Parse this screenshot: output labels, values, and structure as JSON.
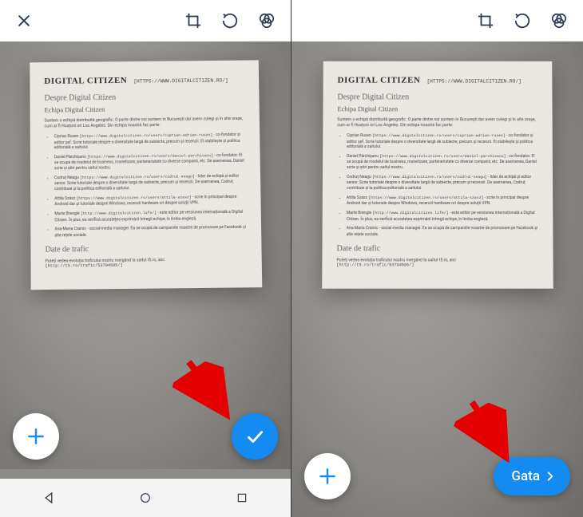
{
  "colors": {
    "accent": "#148bf0"
  },
  "topbar": {
    "close_icon": "close",
    "crop_icon": "crop",
    "rotate_icon": "rotate",
    "filters_icon": "color-filters"
  },
  "document": {
    "logo": "DIGITAL CITIZEN",
    "url": "[HTTPS://WWW.DIGITALCITIZEN.RO/]",
    "h2": "Despre Digital Citizen",
    "h3": "Echipa Digital Citizen",
    "intro": "Suntem o echipă distribuită geografic. O parte dintre noi suntem în București dar avem colegi și în alte orașe, cum ar fi Huațoni ori Los Angeles. Din echipa noastră fac parte:",
    "members": [
      {
        "name": "Ciprian Rusen",
        "link": "[https://www.digitalcitizen.ro/users/ciprian-adrian-rusen]",
        "desc": " - co-fondator și editor șef. Scrie tutoriale despre o diversitate largă de subiecte, precum și recenzii. El stabilește și politica editorială a saitului."
      },
      {
        "name": "Daniel Pârchișanu",
        "link": "[https://www.digitalcitizen.ro/users/daniel-parchisanu]",
        "desc": " - co-fondator. El se ocupă de modelul de business, monetizare, parteneriatele cu diverse companii, etc. De asemenea, Daniel scrie și știri pentru saitul nostru."
      },
      {
        "name": "Codruț Neagu",
        "link": "[https://www.digitalcitizen.ro/users/codrut-neagu]",
        "desc": " - lider de echipă și editor senior. Scrie tutoriale despre o diversitate largă de subiecte, precum și recenzii. De asemenea, Codruț contribuie și la politica editorială a saitului."
      },
      {
        "name": "Attila Szász",
        "link": "[https://www.digitalcitizen.ro/users/attila-szasz]",
        "desc": " - scrie în principal despre Android dar și tutoriale despre Windows, recenzii hardware ori despre soluții VPN."
      },
      {
        "name": "Marte Brengle",
        "link": "[http://www.digitalcitizen.life/]",
        "desc": " - este editor pe versiunea internațională a Digital Citizen. În plus, ea verifică acuratețea exprimării întregii echipe, în limba engleză."
      },
      {
        "name": "Ana-Maria Crainic",
        "link": "",
        "desc": " - social-media manager. Ea se ocupă de campaniile noastre de promovare pe Facebook și alte rețele sociale."
      }
    ],
    "h2b": "Date de trafic",
    "outro": "Puteți vedea evoluția traficului nostru mergând la saitul t5.ro, aici",
    "outro_link": "[http://t5.ro/trafic/53794595/]"
  },
  "left": {
    "add_label": "add",
    "confirm_label": "confirm"
  },
  "right": {
    "add_label": "add",
    "done_label": "Gata"
  }
}
